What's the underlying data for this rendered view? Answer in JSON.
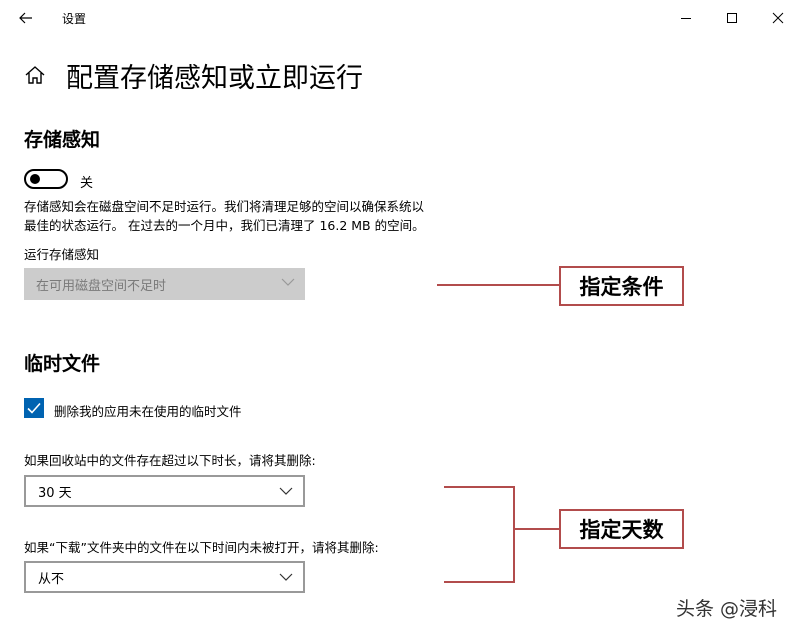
{
  "window": {
    "app_title": "设置",
    "icons": {
      "back": "back-arrow-icon",
      "minimize": "minimize-icon",
      "maximize": "maximize-icon",
      "close": "close-icon",
      "home": "home-icon"
    }
  },
  "page": {
    "title": "配置存储感知或立即运行"
  },
  "storage_sense": {
    "title": "存储感知",
    "toggle_state": "关",
    "toggle_on": false,
    "description_lines": [
      "存储感知会在磁盘空间不足时运行。我们将清理足够的空间以确保系统以",
      "最佳的状态运行。 在过去的一个月中，我们已清理了 16.2 MB 的空间。"
    ],
    "run_label": "运行存储感知",
    "run_value": "在可用磁盘空间不足时"
  },
  "temp_files": {
    "title": "临时文件",
    "checkbox_label": "删除我的应用未在使用的临时文件",
    "checkbox_checked": true,
    "recycle_label": "如果回收站中的文件存在超过以下时长，请将其删除:",
    "recycle_value": "30 天",
    "downloads_label": "如果“下载”文件夹中的文件在以下时间内未被打开，请将其删除:",
    "downloads_value": "从不"
  },
  "annotations": {
    "condition": "指定条件",
    "days": "指定天数",
    "color": "#b24c4c"
  },
  "watermark": "头条 @浸科",
  "colors": {
    "accent": "#0063b1",
    "disabled_bg": "#cccccc",
    "disabled_text": "#7a7a7a"
  }
}
